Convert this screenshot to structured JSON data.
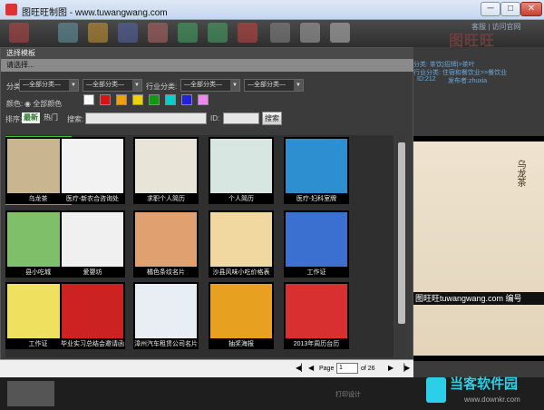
{
  "window": {
    "title": "图旺旺制图 - www.tuwangwang.com",
    "min": "─",
    "max": "□",
    "close": "✕"
  },
  "toolbar": {
    "top_links": "客服 | 访问官网",
    "brand": "图旺旺"
  },
  "dialog": {
    "title": "选择模板",
    "subtitle": "请选择...",
    "filter_label": "分类:",
    "sel1": "—全部分类—",
    "sel2": "—全部分类—",
    "industry_label": "行业分类:",
    "sel3": "—全部分类—",
    "sel4": "—全部分类—",
    "color_label": "颜色:",
    "all_colors": "全部颜色",
    "swatches": [
      "#ffffff",
      "#dd1111",
      "#f0a000",
      "#f0d000",
      "#119911",
      "#00d0d0",
      "#2222dd",
      "#ee88ee"
    ],
    "sort_label": "排序:",
    "newest": "最新",
    "hot": "热门",
    "search_label": "搜索:",
    "id_label": "ID:",
    "search_button": "搜索"
  },
  "thumbs": [
    {
      "caption": "乌龙茶",
      "color": "#c9b58f"
    },
    {
      "caption": "医疗-新农合咨询处",
      "color": "#f2f2f2"
    },
    {
      "caption": "求职个人简历",
      "color": "#e8e4d8"
    },
    {
      "caption": "个人简历",
      "color": "#d7e6e0"
    },
    {
      "caption": "医疗-妇科室牌",
      "color": "#2d8fd0"
    },
    {
      "caption": "县小吃城",
      "color": "#7fbf6a"
    },
    {
      "caption": "爱婴坊",
      "color": "#f0f0f0"
    },
    {
      "caption": "橘色条纹名片",
      "color": "#e0a070"
    },
    {
      "caption": "沙县风味小吃价格表",
      "color": "#f0d8a0"
    },
    {
      "caption": "工作证",
      "color": "#3b6fd0"
    },
    {
      "caption": "工作证",
      "color": "#f0e060"
    },
    {
      "caption": "毕业实习总结会邀请函",
      "color": "#cc2222"
    },
    {
      "caption": "漳州汽车租赁公司名片",
      "color": "#e8eef4"
    },
    {
      "caption": "抽奖海报",
      "color": "#e8a020"
    },
    {
      "caption": "2013年周历台历",
      "color": "#d83030"
    }
  ],
  "pager": {
    "first": "◀▏",
    "prev": "◀",
    "page_label": "Page",
    "page_value": "1",
    "of_label": "of 26",
    "next": "▶",
    "last": "▕▶"
  },
  "right_panel": {
    "category": "分类: 茶饮|招牌|>茶叶",
    "industry": "行业分类: 住宿和餐饮业>>餐饮业",
    "id": "ID:212",
    "publisher": "发布者:zhuxia",
    "preview_title": "乌龙茶",
    "preview_watermark": "图旺旺tuwangwang.com 编号"
  },
  "bottom": {
    "tab2": "打印设计"
  },
  "watermark": {
    "text": "当客软件园",
    "url": "www.downkr.com"
  }
}
